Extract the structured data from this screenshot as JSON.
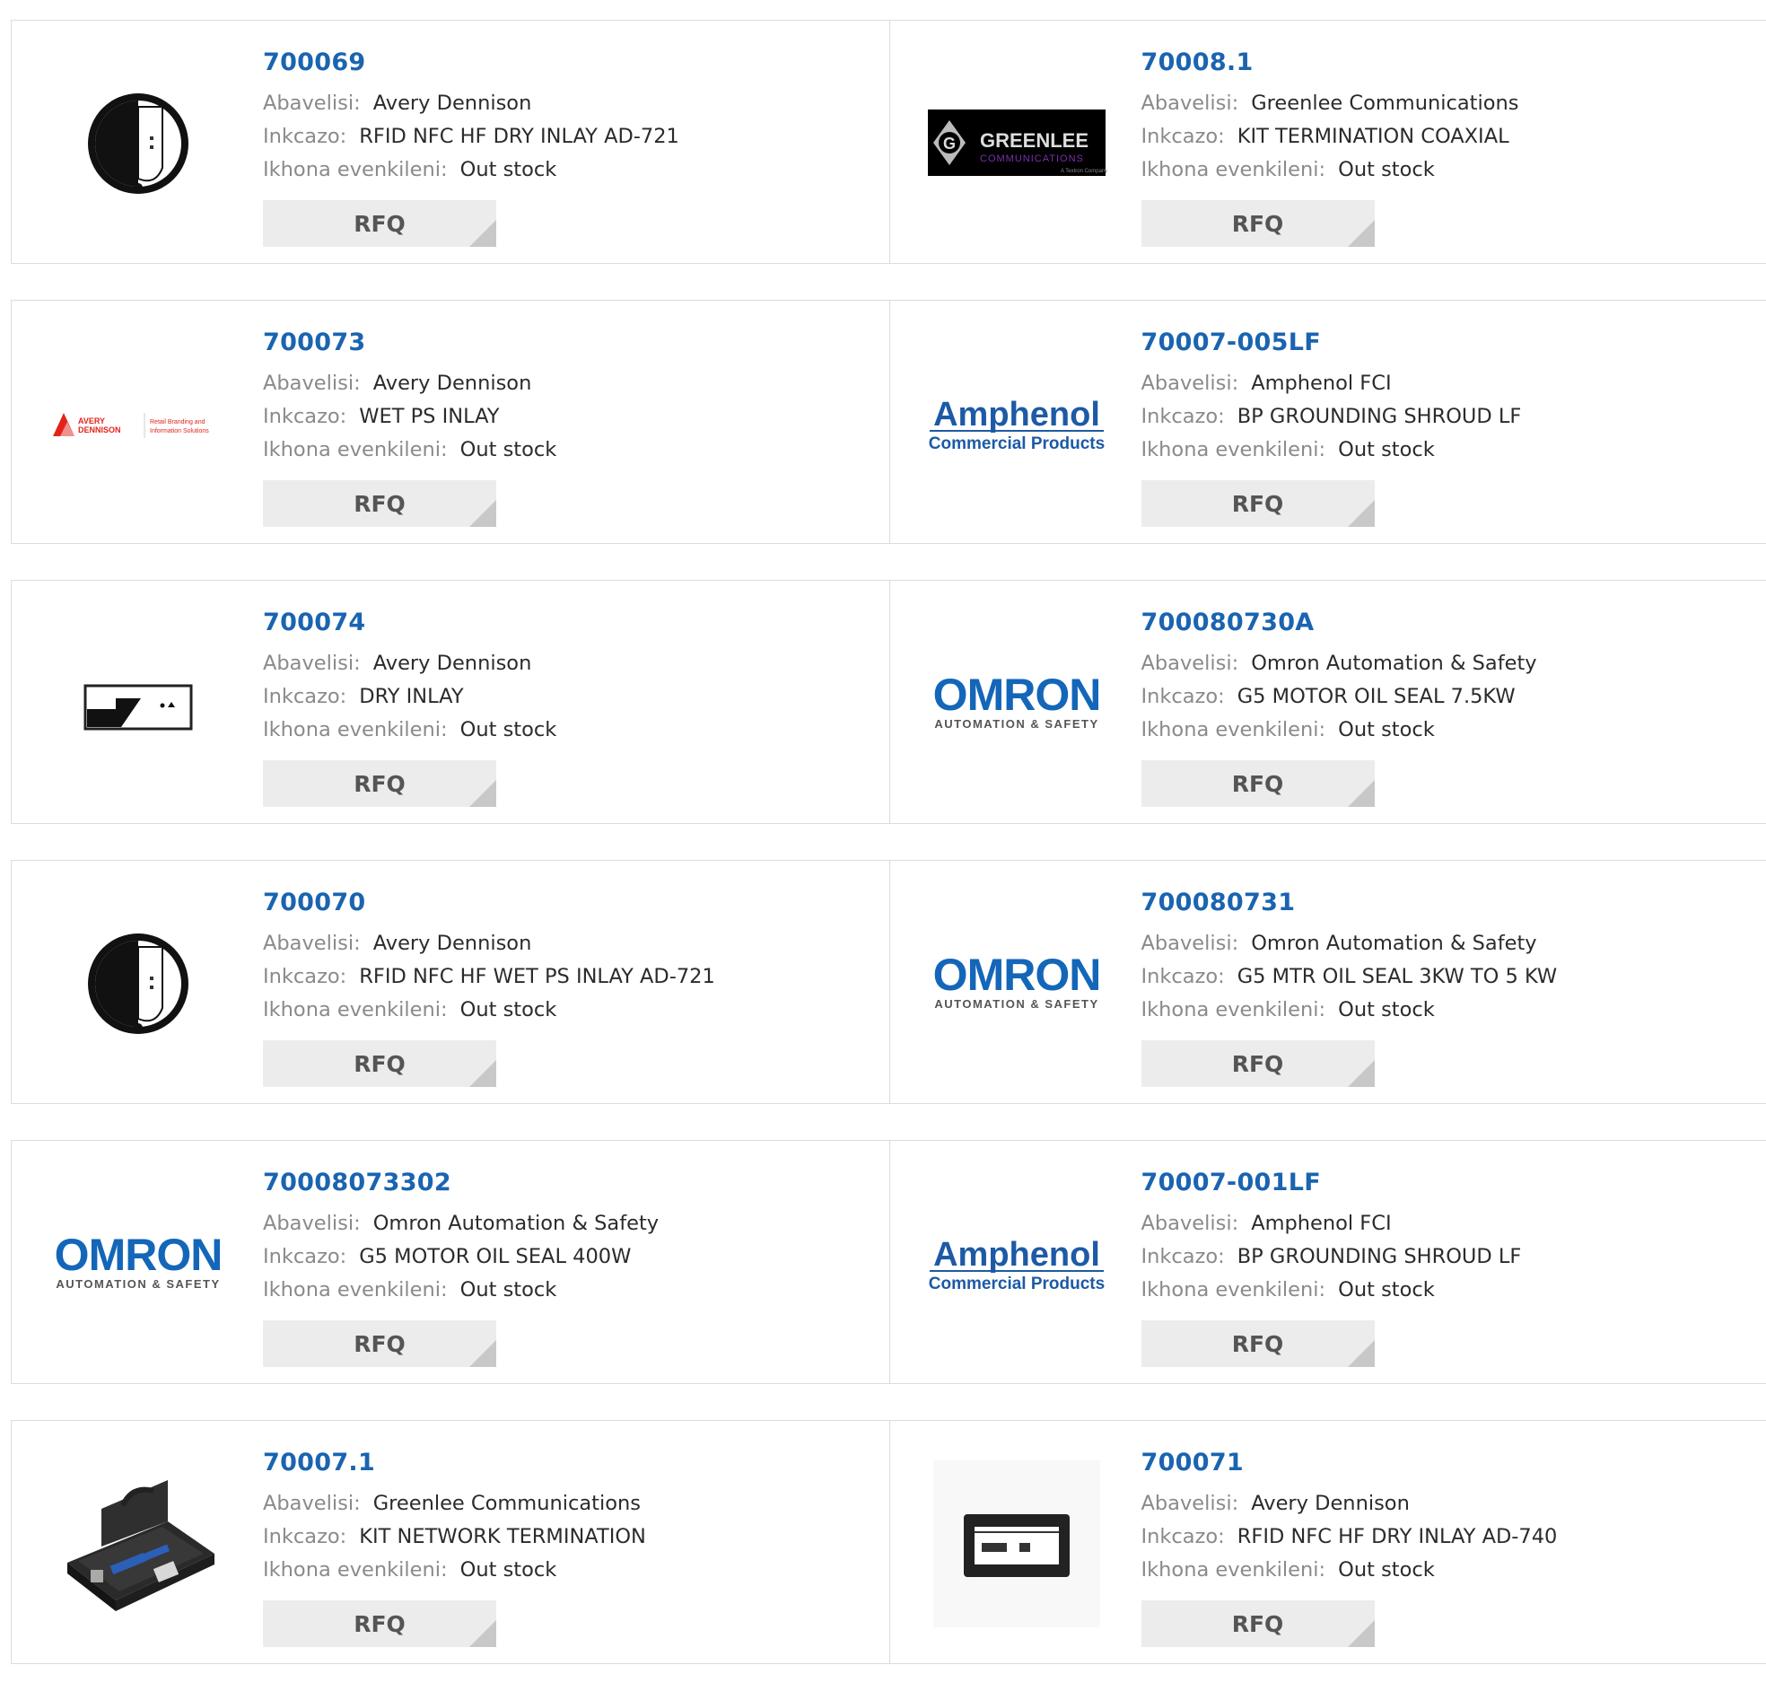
{
  "labels": {
    "manufacturer": "Abavelisi:",
    "description": "Inkcazo:",
    "stock": "Ikhona evenkileni:",
    "rfq": "RFQ"
  },
  "products": [
    {
      "part": "700069",
      "manufacturer": "Avery Dennison",
      "description": "RFID NFC HF DRY INLAY AD-721",
      "stock": "Out stock",
      "image": "round-inlay"
    },
    {
      "part": "70008.1",
      "manufacturer": "Greenlee Communications",
      "description": "KIT TERMINATION COAXIAL",
      "stock": "Out stock",
      "image": "greenlee-logo"
    },
    {
      "part": "700073",
      "manufacturer": "Avery Dennison",
      "description": "WET PS INLAY",
      "stock": "Out stock",
      "image": "avery-dennison-logo"
    },
    {
      "part": "70007-005LF",
      "manufacturer": "Amphenol FCI",
      "description": "BP GROUNDING SHROUD LF",
      "stock": "Out stock",
      "image": "amphenol-logo"
    },
    {
      "part": "700074",
      "manufacturer": "Avery Dennison",
      "description": "DRY INLAY",
      "stock": "Out stock",
      "image": "rect-inlay"
    },
    {
      "part": "700080730A",
      "manufacturer": "Omron Automation & Safety",
      "description": "G5 MOTOR OIL SEAL 7.5KW",
      "stock": "Out stock",
      "image": "omron-logo"
    },
    {
      "part": "700070",
      "manufacturer": "Avery Dennison",
      "description": "RFID NFC HF WET PS INLAY AD-721",
      "stock": "Out stock",
      "image": "round-inlay"
    },
    {
      "part": "700080731",
      "manufacturer": "Omron Automation & Safety",
      "description": "G5 MTR OIL SEAL 3KW TO 5 KW",
      "stock": "Out stock",
      "image": "omron-logo"
    },
    {
      "part": "70008073302",
      "manufacturer": "Omron Automation & Safety",
      "description": "G5 MOTOR OIL SEAL 400W",
      "stock": "Out stock",
      "image": "omron-logo"
    },
    {
      "part": "70007-001LF",
      "manufacturer": "Amphenol FCI",
      "description": "BP GROUNDING SHROUD LF",
      "stock": "Out stock",
      "image": "amphenol-logo"
    },
    {
      "part": "70007.1",
      "manufacturer": "Greenlee Communications",
      "description": "KIT NETWORK TERMINATION",
      "stock": "Out stock",
      "image": "tool-case"
    },
    {
      "part": "700071",
      "manufacturer": "Avery Dennison",
      "description": "RFID NFC HF DRY INLAY AD-740",
      "stock": "Out stock",
      "image": "card-inlay"
    }
  ],
  "logo_text": {
    "greenlee": "GREENLEE",
    "greenlee_sub": "COMMUNICATIONS",
    "greenlee_tag": "A Textron Company",
    "amphenol": "Amphenol",
    "amphenol_sub": "Commercial Products",
    "omron": "OMRON",
    "omron_sub": "AUTOMATION & SAFETY",
    "avery": "AVERY DENNISON",
    "avery_sub": "Retail Branding and Information Solutions"
  },
  "colors": {
    "link": "#1a64b0",
    "amphenol": "#1d5aa6",
    "omron": "#1466b8",
    "avery_red": "#e2231a",
    "greenlee_purple": "#7a2fb0"
  }
}
